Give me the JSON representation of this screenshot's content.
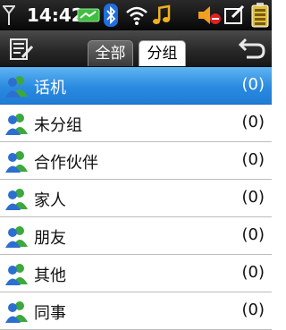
{
  "status_bar": {
    "time": "14:42",
    "icons": [
      "signal-icon",
      "battery-status-icon",
      "bluetooth-icon",
      "wifi-icon",
      "music-icon",
      "mute-icon",
      "edit-icon",
      "battery-icon"
    ]
  },
  "header": {
    "tabs": [
      {
        "label": "全部",
        "active": false
      },
      {
        "label": "分组",
        "active": true
      }
    ],
    "left_icon": "edit-list-icon",
    "right_icon": "back-icon"
  },
  "groups": [
    {
      "label": "话机",
      "count": "(0)",
      "selected": true
    },
    {
      "label": "未分组",
      "count": "(0)"
    },
    {
      "label": "合作伙伴",
      "count": "(0)"
    },
    {
      "label": "家人",
      "count": "(0)"
    },
    {
      "label": "朋友",
      "count": "(0)"
    },
    {
      "label": "其他",
      "count": "(0)"
    },
    {
      "label": "同事",
      "count": "(0)"
    }
  ],
  "colors": {
    "accent": "#2a8ae0",
    "contact_green": "#3da83d",
    "contact_blue": "#2c6fd0"
  }
}
